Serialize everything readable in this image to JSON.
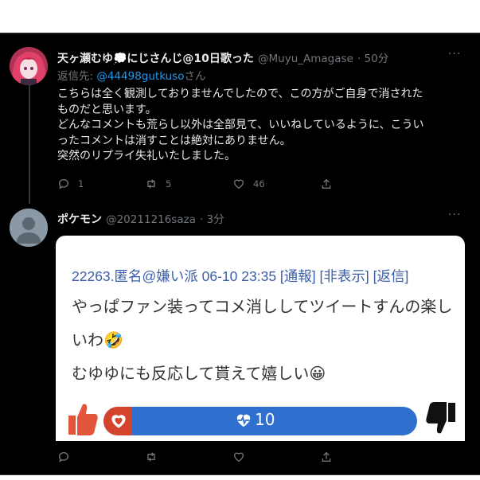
{
  "tweet1": {
    "display_name": "天ヶ瀬むゆ💭にじさんじ@10日歌った",
    "handle": "@Muyu_Amagase",
    "time": "· 50分",
    "reply_prefix": "返信先: ",
    "reply_mention": "@44498gutkuso",
    "reply_suffix": "さん",
    "lines": [
      "こちらは全く観測しておりませんでしたので、この方がご自身で消された",
      "ものだと思います。",
      "どんなコメントも荒らし以外は全部見て、いいねしているように、こうい",
      "ったコメントは消すことは絶対にありません。",
      "突然のリプライ失礼いたしました。"
    ],
    "reply_count": "1",
    "retweet_count": "5",
    "like_count": "46"
  },
  "tweet2": {
    "display_name": "ポケモン",
    "handle": "@20211216saza",
    "time": "· 3分",
    "embed": {
      "header": "22263.匿名@嫌い派 06-10 23:35  [通報]  [非表示]  [返信]",
      "line1": "やっぱファン装ってコメ消ししてツイートすんの楽し",
      "line2": "いわ🤣",
      "line3": "むゆゆにも反応して貰えて嬉しい😀",
      "vote_count": "10"
    }
  },
  "more_label": "···",
  "colors": {
    "background": "#000000",
    "text": "#e7e9ea",
    "muted": "#71767b",
    "link": "#1d9bf0"
  }
}
